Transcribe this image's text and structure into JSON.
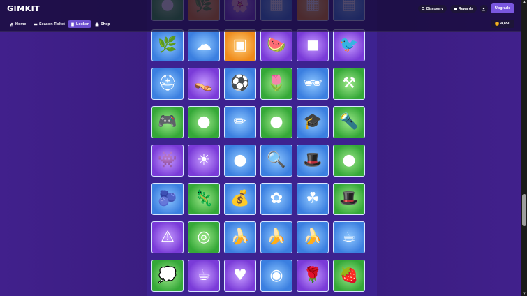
{
  "logo": "GIMKIT",
  "nav": [
    {
      "label": "Home",
      "icon": "home-icon"
    },
    {
      "label": "Season Ticket",
      "icon": "ticket-icon"
    },
    {
      "label": "Locker",
      "icon": "locker-icon"
    },
    {
      "label": "Shop",
      "icon": "shop-icon"
    }
  ],
  "header": {
    "discovery": "Discovery",
    "rewards": "Rewards",
    "upgrade": "Upgrade",
    "coins": "4,850"
  },
  "items": [
    {
      "name": "plant-blob",
      "glyph": "🌿",
      "color": "blue"
    },
    {
      "name": "cloud-blob",
      "glyph": "☁",
      "color": "blue"
    },
    {
      "name": "photo-frame",
      "glyph": "▣",
      "color": "orange"
    },
    {
      "name": "watermelon",
      "glyph": "🍉",
      "color": "purple"
    },
    {
      "name": "brown-bear",
      "glyph": "◼",
      "color": "purple"
    },
    {
      "name": "birds",
      "glyph": "🐦",
      "color": "purple"
    },
    {
      "name": "miner",
      "glyph": "⛑",
      "color": "blue"
    },
    {
      "name": "flip-flops",
      "glyph": "👡",
      "color": "purple"
    },
    {
      "name": "beach-balls",
      "glyph": "⚽",
      "color": "blue"
    },
    {
      "name": "potted-flower",
      "glyph": "🌷",
      "color": "green"
    },
    {
      "name": "sunglasses",
      "glyph": "🕶",
      "color": "blue"
    },
    {
      "name": "hammer",
      "glyph": "⚒",
      "color": "green"
    },
    {
      "name": "game-controller",
      "glyph": "🎮",
      "color": "green"
    },
    {
      "name": "yellow-blob",
      "glyph": "●",
      "color": "green"
    },
    {
      "name": "crayons",
      "glyph": "✏",
      "color": "blue"
    },
    {
      "name": "teal-blob",
      "glyph": "●",
      "color": "green"
    },
    {
      "name": "graduate",
      "glyph": "🎓",
      "color": "blue"
    },
    {
      "name": "flashlight",
      "glyph": "🔦",
      "color": "green"
    },
    {
      "name": "monster",
      "glyph": "👾",
      "color": "purple"
    },
    {
      "name": "sun",
      "glyph": "☀",
      "color": "purple"
    },
    {
      "name": "black-blob",
      "glyph": "●",
      "color": "blue"
    },
    {
      "name": "magnifier",
      "glyph": "🔍",
      "color": "blue"
    },
    {
      "name": "top-hat",
      "glyph": "🎩",
      "color": "blue"
    },
    {
      "name": "dark-blob",
      "glyph": "●",
      "color": "green"
    },
    {
      "name": "blueberry-blob",
      "glyph": "🫐",
      "color": "blue"
    },
    {
      "name": "axolotl",
      "glyph": "🦎",
      "color": "green"
    },
    {
      "name": "treasure-chest",
      "glyph": "💰",
      "color": "blue"
    },
    {
      "name": "spring-text",
      "glyph": "✿",
      "color": "blue"
    },
    {
      "name": "clover",
      "glyph": "☘",
      "color": "blue"
    },
    {
      "name": "leprechaun-hat",
      "glyph": "🎩",
      "color": "green"
    },
    {
      "name": "keep-out-sign",
      "glyph": "⚠",
      "color": "purple"
    },
    {
      "name": "duct-tape",
      "glyph": "◎",
      "color": "green"
    },
    {
      "name": "banana-blob",
      "glyph": "🍌",
      "color": "blue"
    },
    {
      "name": "banana-peel",
      "glyph": "🍌",
      "color": "blue"
    },
    {
      "name": "banana-bunch",
      "glyph": "🍌",
      "color": "blue"
    },
    {
      "name": "love-mug",
      "glyph": "☕",
      "color": "blue"
    },
    {
      "name": "speech-cloud",
      "glyph": "💭",
      "color": "green"
    },
    {
      "name": "cocoa-mug",
      "glyph": "☕",
      "color": "purple"
    },
    {
      "name": "heart-candy",
      "glyph": "♥",
      "color": "purple"
    },
    {
      "name": "zero-g-badge",
      "glyph": "◉",
      "color": "blue"
    },
    {
      "name": "rose-bouquet",
      "glyph": "🌹",
      "color": "purple"
    },
    {
      "name": "strawberry",
      "glyph": "🍓",
      "color": "green"
    }
  ],
  "top_row": [
    {
      "glyph": "●",
      "color": "green"
    },
    {
      "glyph": "🌿",
      "color": "orange"
    },
    {
      "glyph": "🌸",
      "color": "purple"
    },
    {
      "glyph": "▦",
      "color": "blue"
    },
    {
      "glyph": "▦",
      "color": "orange"
    },
    {
      "glyph": "▦",
      "color": "blue"
    }
  ]
}
